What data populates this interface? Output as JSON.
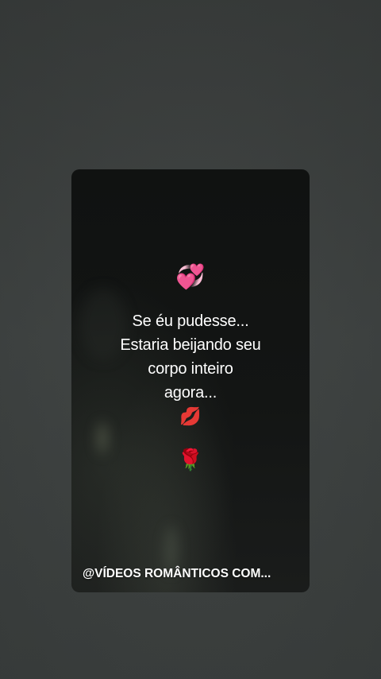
{
  "card": {
    "emoji_top": "💞",
    "lines": [
      "Se éu pudesse...",
      "Estaria beijando seu",
      "corpo inteiro",
      "agora..."
    ],
    "emoji_kiss": "💋",
    "emoji_rose": "🌹",
    "watermark": "@VÍDEOS ROMÂNTICOS COM..."
  },
  "colors": {
    "background": "#3f4342",
    "card_background": "#131514",
    "text": "#ffffff"
  }
}
